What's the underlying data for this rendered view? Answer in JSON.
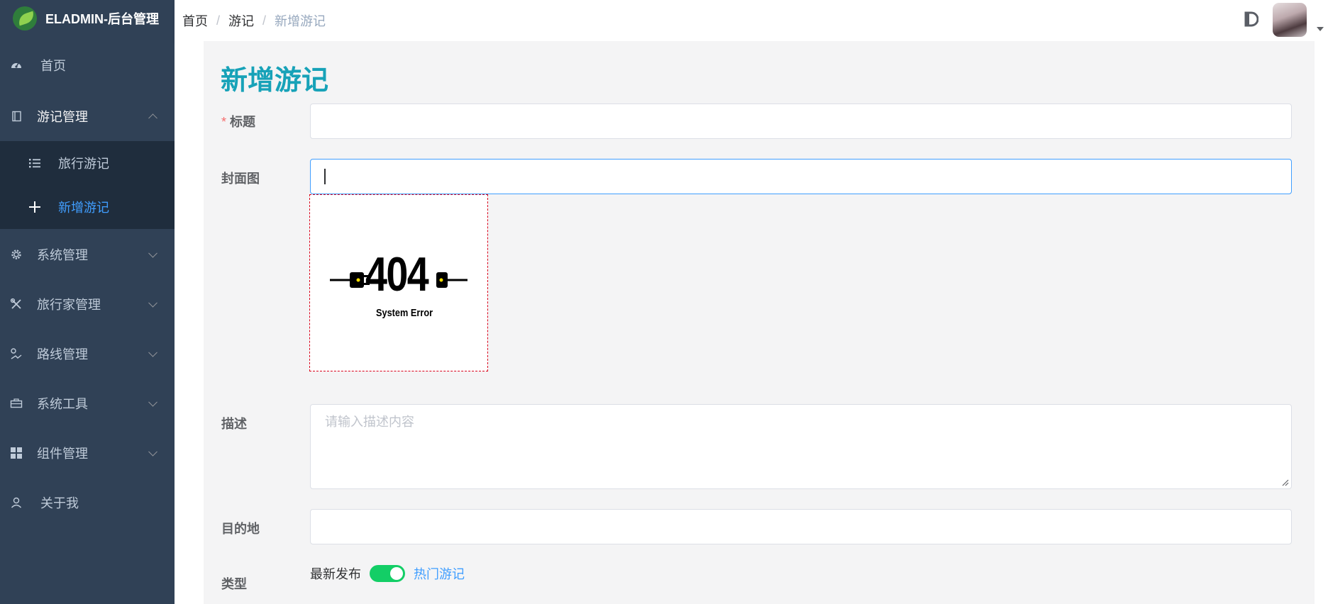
{
  "app": {
    "title": "ELADMIN-后台管理"
  },
  "sidebar": {
    "items": [
      {
        "label": "首页",
        "icon": "dashboard-icon"
      },
      {
        "label": "游记管理",
        "icon": "book-icon",
        "expanded": true,
        "children": [
          {
            "label": "旅行游记",
            "icon": "list-icon"
          },
          {
            "label": "新增游记",
            "icon": "plus-icon",
            "active": true
          }
        ]
      },
      {
        "label": "系统管理",
        "icon": "gear-icon"
      },
      {
        "label": "旅行家管理",
        "icon": "tools-icon"
      },
      {
        "label": "路线管理",
        "icon": "route-icon"
      },
      {
        "label": "系统工具",
        "icon": "toolbox-icon"
      },
      {
        "label": "组件管理",
        "icon": "grid-icon"
      },
      {
        "label": "关于我",
        "icon": "user-icon"
      }
    ]
  },
  "breadcrumb": [
    "首页",
    "游记",
    "新增游记"
  ],
  "form": {
    "title": "新增游记",
    "fields": {
      "title_label": "标题",
      "title_required": "*",
      "title_value": "",
      "cover_label": "封面图",
      "cover_value": "",
      "description_label": "描述",
      "description_placeholder": "请输入描述内容",
      "destination_label": "目的地",
      "destination_value": "",
      "type_label": "类型",
      "type_off_text": "最新发布",
      "type_on_text": "热门游记",
      "type_switch_on": true
    },
    "cover_preview": {
      "code": "404",
      "message": "System Error"
    }
  },
  "colors": {
    "sidebar_bg": "#304156",
    "submenu_bg": "#1f2d3d",
    "active": "#409eff",
    "title": "#17a2b8",
    "switch_on": "#13ce66",
    "required": "#f56c6c"
  }
}
